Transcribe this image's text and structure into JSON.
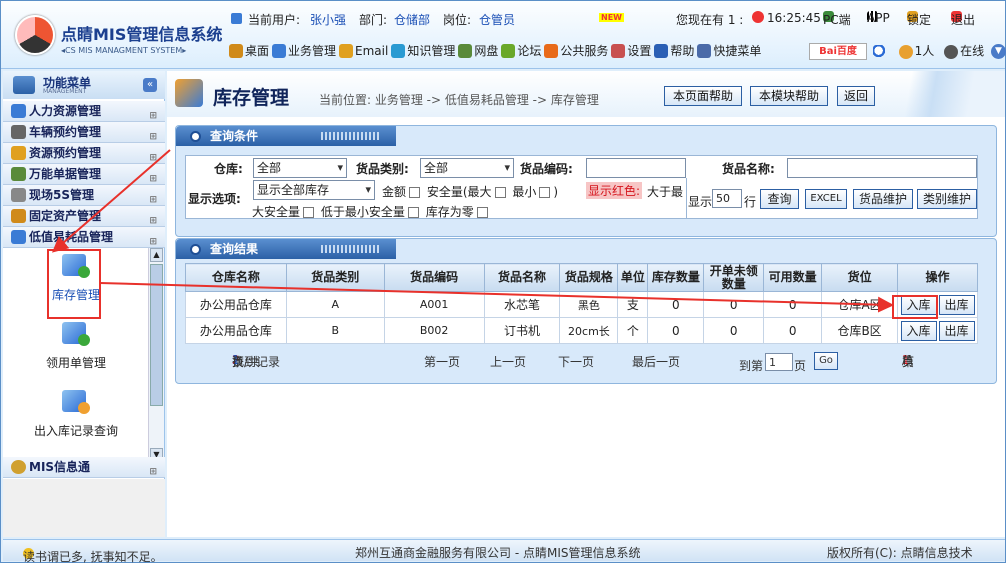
{
  "app": {
    "logo_title": "点睛MIS管理信息系统",
    "logo_subtitle": "◂CS MIS MANAGMENT SYSTEM▸"
  },
  "user_bar": {
    "user_label": "当前用户:",
    "user_name": "张小强",
    "dept_label": "部门:",
    "dept_name": "仓储部",
    "post_label": "岗位:",
    "post_name": "仓管员",
    "new_badge": "NEW",
    "online_text": "您现在有 1 :",
    "clock": "16:25:45",
    "pc_label": "PC端",
    "app_label": "APP",
    "lock_label": "锁定",
    "exit_label": "退出"
  },
  "nav": [
    {
      "label": "桌面",
      "icon": "monitor-icon",
      "color": "#d08a1a"
    },
    {
      "label": "业务管理",
      "icon": "people-icon",
      "color": "#3a7bd5"
    },
    {
      "label": "Email",
      "icon": "email-icon",
      "color": "#e0a020"
    },
    {
      "label": "知识管理",
      "icon": "knowledge-icon",
      "color": "#2a9ad2"
    },
    {
      "label": "网盘",
      "icon": "disk-icon",
      "color": "#5a8a3a"
    },
    {
      "label": "论坛",
      "icon": "forum-icon",
      "color": "#6aa82a"
    },
    {
      "label": "公共服务",
      "icon": "service-icon",
      "color": "#e86a1a"
    },
    {
      "label": "设置",
      "icon": "settings-icon",
      "color": "#c85050"
    },
    {
      "label": "帮助",
      "icon": "help-icon",
      "color": "#2a5fb5"
    },
    {
      "label": "快捷菜单",
      "icon": "shortcut-icon",
      "color": "#4a6aa8"
    }
  ],
  "toolbar_right": {
    "baidu_label": "Bai百度",
    "online_count": "1人",
    "online_label": "在线"
  },
  "sidebar": {
    "title": "功能菜单",
    "subtitle": "MANAGEMENT",
    "collapse": "«",
    "items": [
      {
        "label": "人力资源管理",
        "icon": "hr-icon"
      },
      {
        "label": "车辆预约管理",
        "icon": "car-icon"
      },
      {
        "label": "资源预约管理",
        "icon": "resource-icon"
      },
      {
        "label": "万能单据管理",
        "icon": "document-icon"
      },
      {
        "label": "现场5S管理",
        "icon": "gear-icon"
      },
      {
        "label": "固定资产管理",
        "icon": "asset-icon"
      },
      {
        "label": "低值易耗品管理",
        "icon": "consumable-icon"
      }
    ],
    "sub_items": [
      {
        "label": "库存管理",
        "icon": "inventory-icon"
      },
      {
        "label": "领用单管理",
        "icon": "requisition-icon"
      },
      {
        "label": "出入库记录查询",
        "icon": "records-icon"
      }
    ],
    "mis_item": "MIS信息通"
  },
  "page": {
    "title": "库存管理",
    "breadcrumb": "当前位置: 业务管理 -> 低值易耗品管理 -> 库存管理",
    "btn_page_help": "本页面帮助",
    "btn_module_help": "本模块帮助",
    "btn_back": "返回"
  },
  "query": {
    "panel_title": "查询条件",
    "warehouse_label": "仓库:",
    "warehouse_value": "全部",
    "category_label": "货品类别:",
    "category_value": "全部",
    "code_label": "货品编码:",
    "code_value": "",
    "name_label": "货品名称:",
    "name_value": "",
    "display_label": "显示选项:",
    "display_value": "显示全部库存",
    "opt_amount": "金额",
    "opt_safe_max": "安全量(最大",
    "opt_min": "最小",
    "opt_close": ")",
    "red_hint": "显示红色:",
    "red_over": "大于最",
    "red_over2": "大安全量",
    "red_under": "低于最小安全量",
    "red_zero": "库存为零",
    "show_label": "显示",
    "show_count": "50",
    "show_unit": "行",
    "btn_query": "查询",
    "btn_excel": "EXCEL",
    "btn_item_maint": "货品维护",
    "btn_cat_maint": "类别维护"
  },
  "results": {
    "panel_title": "查询结果",
    "columns": [
      "仓库名称",
      "货品类别",
      "货品编码",
      "货品名称",
      "货品规格",
      "单位",
      "库存数量",
      "开单未领数量",
      "可用数量",
      "货位",
      "操作"
    ],
    "rows": [
      {
        "warehouse": "办公用品仓库",
        "category": "A",
        "code": "A001",
        "name": "水芯笔",
        "spec": "黑色",
        "unit": "支",
        "stock": "0",
        "pending": "0",
        "available": "0",
        "location": "仓库A区",
        "in": "入库",
        "out": "出库"
      },
      {
        "warehouse": "办公用品仓库",
        "category": "B",
        "code": "B002",
        "name": "订书机",
        "spec": "20cm长",
        "unit": "个",
        "stock": "0",
        "pending": "0",
        "available": "0",
        "location": "仓库B区",
        "in": "入库",
        "out": "出库"
      }
    ],
    "pager": {
      "found": "找到记录",
      "count": "2",
      "mid": "条/共",
      "pages": "1",
      "page_word": "页",
      "first": "第一页",
      "prev": "上一页",
      "next": "下一页",
      "last": "最后一页",
      "goto_label": "到第",
      "goto_value": "1",
      "goto_unit": "页",
      "go": "Go",
      "cur_prefix": "第",
      "cur": "1",
      "cur_total": "/1",
      "cur_suffix": "页"
    }
  },
  "status": {
    "left": "读书谓已多, 抚事知不足。",
    "center": "郑州互通商金融服务有限公司 - 点睛MIS管理信息系统",
    "right": "版权所有(C): 点睛信息技术"
  },
  "colors": {
    "accent": "#2b60a6",
    "annotation": "#e8312b",
    "header_bg": "#dceefd"
  }
}
